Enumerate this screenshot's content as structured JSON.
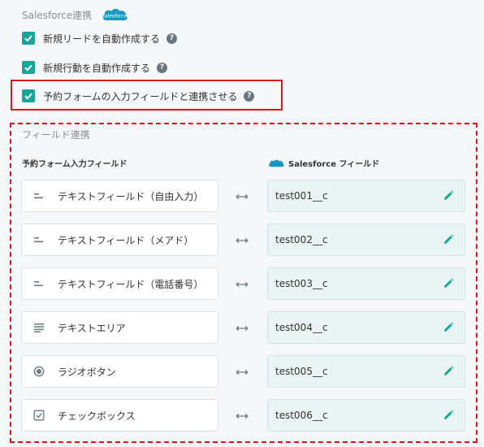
{
  "salesforce": {
    "title": "Salesforce連携",
    "logo_text": "salesforce",
    "brand_color": "#1798c1"
  },
  "options": [
    {
      "label": "新規リードを自動作成する",
      "checked": true
    },
    {
      "label": "新規行動を自動作成する",
      "checked": true
    },
    {
      "label": "予約フォームの入力フィールドと連携させる",
      "checked": true
    }
  ],
  "field_mapping": {
    "title": "フィールド連携",
    "left_header": "予約フォーム入力フィールド",
    "right_header": "Salesforce フィールド",
    "rows": [
      {
        "icon": "short-text-icon",
        "label": "テキストフィールド（自由入力）",
        "sf_field": "test001__c"
      },
      {
        "icon": "short-text-icon",
        "label": "テキストフィールド（メアド）",
        "sf_field": "test002__c"
      },
      {
        "icon": "short-text-icon",
        "label": "テキストフィールド（電話番号）",
        "sf_field": "test003__c"
      },
      {
        "icon": "long-text-icon",
        "label": "テキストエリア",
        "sf_field": "test004__c"
      },
      {
        "icon": "radio-icon",
        "label": "ラジオボタン",
        "sf_field": "test005__c"
      },
      {
        "icon": "checkbox-icon",
        "label": "チェックボックス",
        "sf_field": "test006__c"
      }
    ]
  },
  "colors": {
    "accent": "#19a69a",
    "highlight": "#e0141e",
    "field_bg": "#e9f5f2"
  }
}
